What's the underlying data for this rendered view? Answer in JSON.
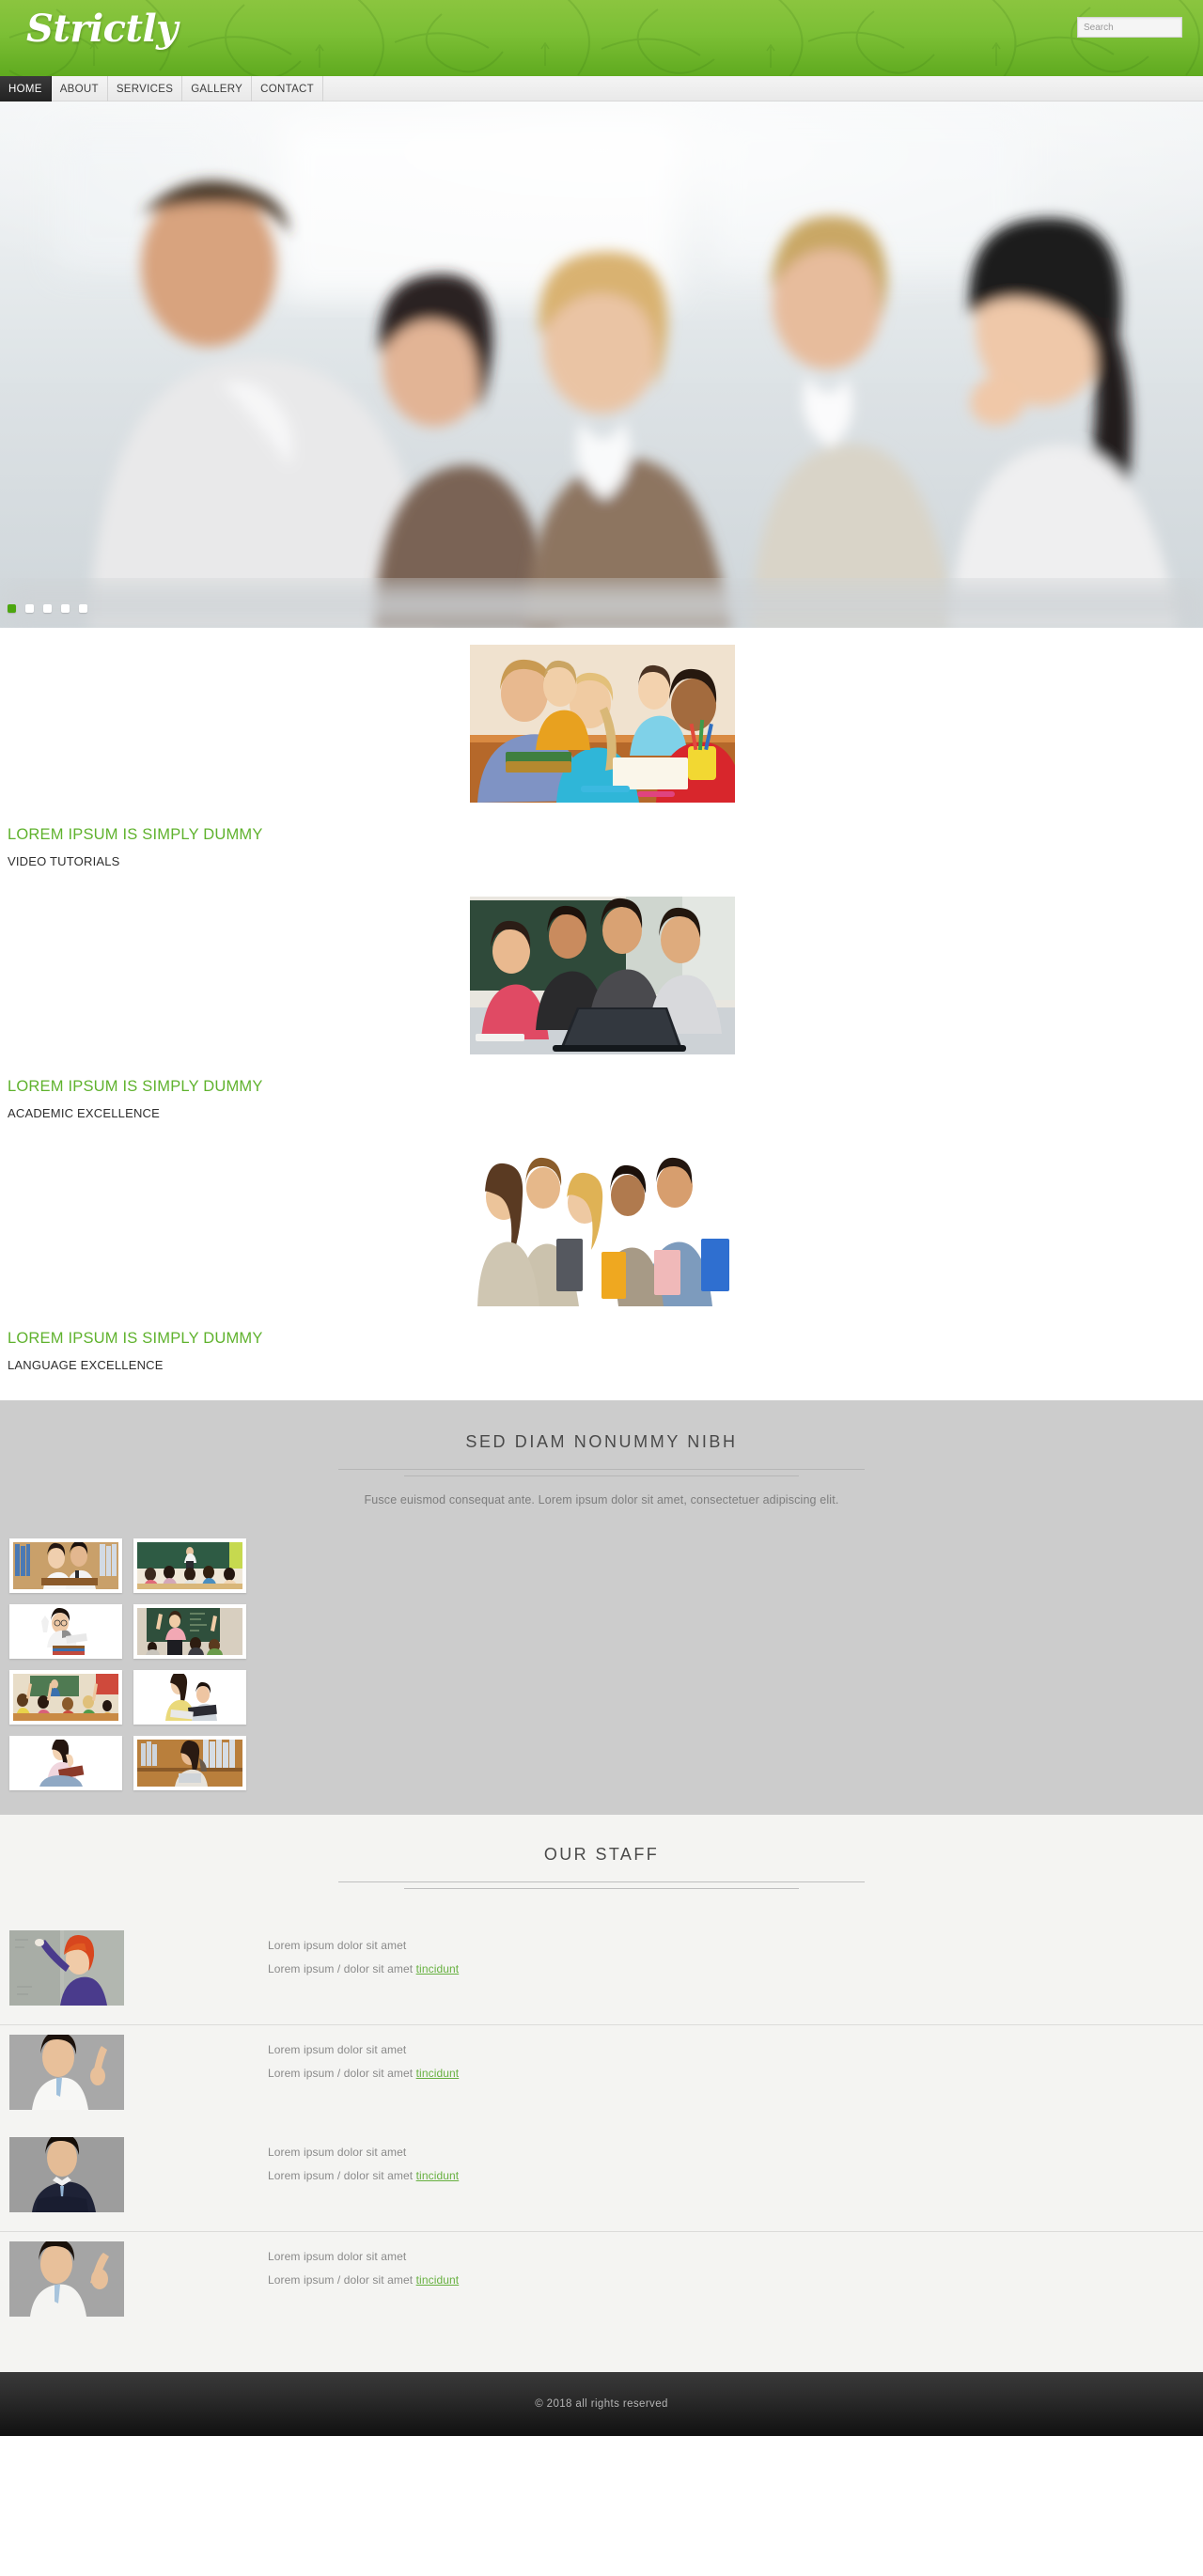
{
  "header": {
    "logo": "Strictly",
    "search": {
      "placeholder": "Search",
      "value": "",
      "icon": "search-icon"
    },
    "brand_color": "#7cbf35"
  },
  "nav": {
    "items": [
      {
        "label": "HOME",
        "active": true
      },
      {
        "label": "ABOUT",
        "active": false
      },
      {
        "label": "SERVICES",
        "active": false
      },
      {
        "label": "GALLERY",
        "active": false
      },
      {
        "label": "CONTACT",
        "active": false
      }
    ]
  },
  "hero": {
    "alt": "classroom-students-photo",
    "dots": [
      {
        "active": true
      },
      {
        "active": false
      },
      {
        "active": false
      },
      {
        "active": false
      },
      {
        "active": false
      }
    ]
  },
  "features": {
    "accent_color": "#5fb22d",
    "items": [
      {
        "title": "LOREM IPSUM IS SIMPLY DUMMY",
        "subtitle": "VIDEO TUTORIALS",
        "image": "teacher-with-children-writing"
      },
      {
        "title": "LOREM IPSUM IS SIMPLY DUMMY",
        "subtitle": "ACADEMIC EXCELLENCE",
        "image": "students-around-laptop"
      },
      {
        "title": "LOREM IPSUM IS SIMPLY DUMMY",
        "subtitle": "LANGUAGE EXCELLENCE",
        "image": "group-of-students-with-folders"
      }
    ]
  },
  "gallery": {
    "title": "SED DIAM NONUMMY NIBH",
    "subtitle": "Fusce euismod consequat ante. Lorem ipsum dolor sit amet, consectetuer adipiscing elit.",
    "background_color": "#cccccc",
    "thumbnails": [
      {
        "alt": "two-students-in-library-reading"
      },
      {
        "alt": "teacher-at-green-chalkboard-with-class"
      },
      {
        "alt": "boy-sitting-on-stack-of-books"
      },
      {
        "alt": "students-raising-hands-at-chalkboard"
      },
      {
        "alt": "classroom-children-raising-hands"
      },
      {
        "alt": "tutor-helping-boy-with-book"
      },
      {
        "alt": "woman-reading-book-on-phone"
      },
      {
        "alt": "girl-with-tablet-in-library"
      }
    ]
  },
  "staff": {
    "title": "OUR STAFF",
    "link_color": "#67b040",
    "members": [
      {
        "photo": "teacher-writing-on-chalkboard",
        "line1": "Lorem ipsum dolor sit amet",
        "line2_prefix": "Lorem ipsum / dolor sit amet ",
        "line2_link": "tincidunt"
      },
      {
        "photo": "man-in-white-shirt-pointing-up",
        "line1": "Lorem ipsum dolor sit amet",
        "line2_prefix": "Lorem ipsum / dolor sit amet ",
        "line2_link": "tincidunt"
      },
      {
        "photo": "man-in-dark-suit-arms-crossed",
        "line1": "Lorem ipsum dolor sit amet",
        "line2_prefix": "Lorem ipsum / dolor sit amet ",
        "line2_link": "tincidunt"
      },
      {
        "photo": "man-in-white-shirt-hand-raised",
        "line1": "Lorem ipsum dolor sit amet",
        "line2_prefix": "Lorem ipsum / dolor sit amet ",
        "line2_link": "tincidunt"
      }
    ]
  },
  "footer": {
    "copyright": "© 2018 all rights reserved"
  }
}
